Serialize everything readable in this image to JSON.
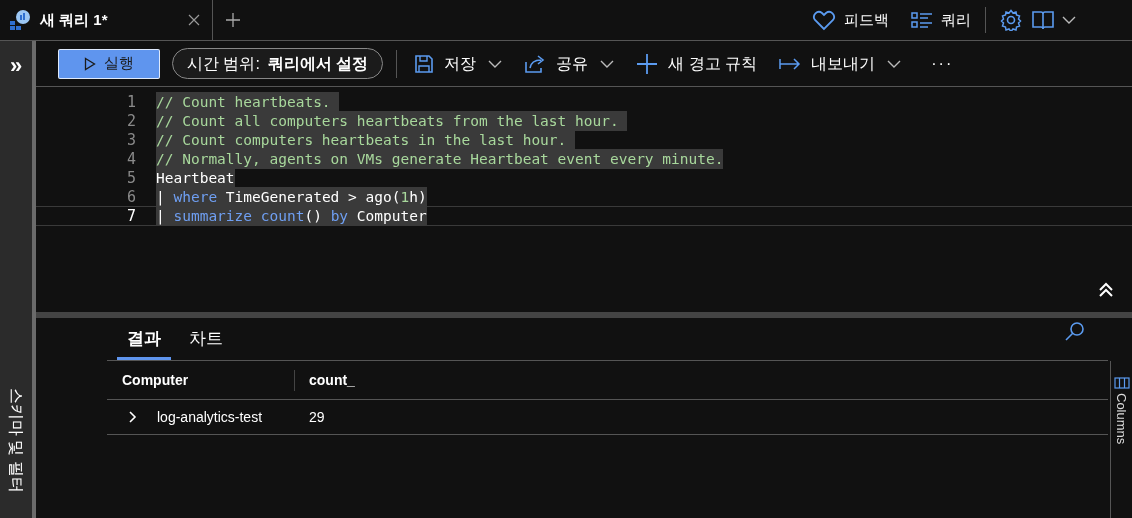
{
  "tabs": [
    {
      "label": "새 쿼리 1*",
      "selected": true
    }
  ],
  "header_actions": [
    {
      "kind": "feedback",
      "label": "피드백"
    },
    {
      "kind": "queries",
      "label": "쿼리"
    }
  ],
  "toolbar": {
    "run": "실행",
    "time_range_label": "시간 범위:",
    "time_range_value": "쿼리에서 설정",
    "items": [
      {
        "kind": "save",
        "label": "저장",
        "dropdown": true
      },
      {
        "kind": "share",
        "label": "공유",
        "dropdown": true
      },
      {
        "kind": "alert",
        "label": "새 경고 규칙",
        "dropdown": false
      },
      {
        "kind": "export",
        "label": "내보내기",
        "dropdown": true
      }
    ],
    "more": "···"
  },
  "sidebar": {
    "toggle": "»",
    "label": "스키마 및 필터"
  },
  "editor": {
    "lines": [
      {
        "number": "1",
        "current": false,
        "tokens": [
          {
            "kind": "comment",
            "text": "// Count heartbeats. "
          }
        ]
      },
      {
        "number": "2",
        "current": false,
        "tokens": [
          {
            "kind": "comment",
            "text": "// Count all computers heartbeats from the last hour. "
          }
        ]
      },
      {
        "number": "3",
        "current": false,
        "tokens": [
          {
            "kind": "comment",
            "text": "// Count computers heartbeats in the last hour. "
          }
        ]
      },
      {
        "number": "4",
        "current": false,
        "tokens": [
          {
            "kind": "comment",
            "text": "// Normally, agents on VMs generate Heartbeat event every minute."
          }
        ]
      },
      {
        "number": "5",
        "current": false,
        "tokens": [
          {
            "kind": "plain",
            "text": "Heartbeat"
          }
        ]
      },
      {
        "number": "6",
        "current": false,
        "tokens": [
          {
            "kind": "plain",
            "text": "| "
          },
          {
            "kind": "keyword",
            "text": "where"
          },
          {
            "kind": "plain",
            "text": " TimeGenerated > ago("
          },
          {
            "kind": "number",
            "text": "1"
          },
          {
            "kind": "plain",
            "text": "h)"
          }
        ]
      },
      {
        "number": "7",
        "current": true,
        "tokens": [
          {
            "kind": "plain",
            "text": "| "
          },
          {
            "kind": "keyword",
            "text": "summarize count"
          },
          {
            "kind": "plain",
            "text": "() "
          },
          {
            "kind": "keyword",
            "text": "by"
          },
          {
            "kind": "plain",
            "text": " Computer"
          }
        ]
      }
    ]
  },
  "results": {
    "tabs": [
      {
        "label": "결과",
        "selected": true
      },
      {
        "label": "차트",
        "selected": false
      }
    ],
    "columns": [
      "Computer",
      "count_"
    ],
    "rows": [
      {
        "expanded": false,
        "cells": [
          "log-analytics-test",
          "29"
        ]
      }
    ],
    "columns_panel": "Columns"
  }
}
